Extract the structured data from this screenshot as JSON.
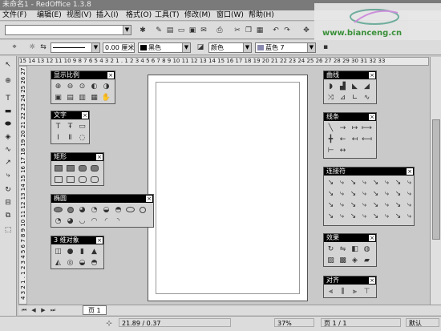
{
  "window": {
    "title": "未命名1 - RedOffice 1.3.8",
    "win_buttons": [
      "_",
      "□",
      "×"
    ]
  },
  "menu": [
    {
      "label": "文件(F)"
    },
    {
      "label": "编辑(E)"
    },
    {
      "label": "视图(V)"
    },
    {
      "label": "插入(I)"
    },
    {
      "label": "格式(O)"
    },
    {
      "label": "工具(T)"
    },
    {
      "label": "修改(M)"
    },
    {
      "label": "窗口(W)"
    },
    {
      "label": "帮助(H)"
    }
  ],
  "watermark": {
    "text": "www.bianceng.cn"
  },
  "toolbar2": {
    "line_width": "0.00 厘米",
    "line_color": "黑色",
    "fill_mode": "颜色",
    "fill_color": "蓝色 7"
  },
  "ruler": {
    "h_ticks": "15 14 13 12 11 10  9  8  7  6  5  4  3  2  1  .  1  2  3  4  5  6  7  8  9 10 11 12 13 14 15 16 17 18 19 20 21 22 23 24 25 26 27 28 29 30 31 32 33",
    "v_ticks": "4 3 2 1 . 1 2 3 4 5 6 7 8 9 10 11 12 13 14 15 16 17 18 19 20 21 22 23 24 25 26 27 28 29"
  },
  "palettes": {
    "zoom": {
      "title": "显示比例"
    },
    "text": {
      "title": "文字"
    },
    "rect": {
      "title": "矩形"
    },
    "ellipse": {
      "title": "椭圆"
    },
    "obj3d": {
      "title": "3 维对象"
    },
    "curve": {
      "title": "曲线"
    },
    "lines": {
      "title": "线条"
    },
    "connector": {
      "title": "连接符"
    },
    "effects": {
      "title": "效果"
    },
    "align": {
      "title": "对齐"
    }
  },
  "tabs": {
    "page": "页 1"
  },
  "status": {
    "position": "21.89 / 0.37",
    "zoom": "37%",
    "page": "页 1 / 1",
    "mode": "默认"
  }
}
